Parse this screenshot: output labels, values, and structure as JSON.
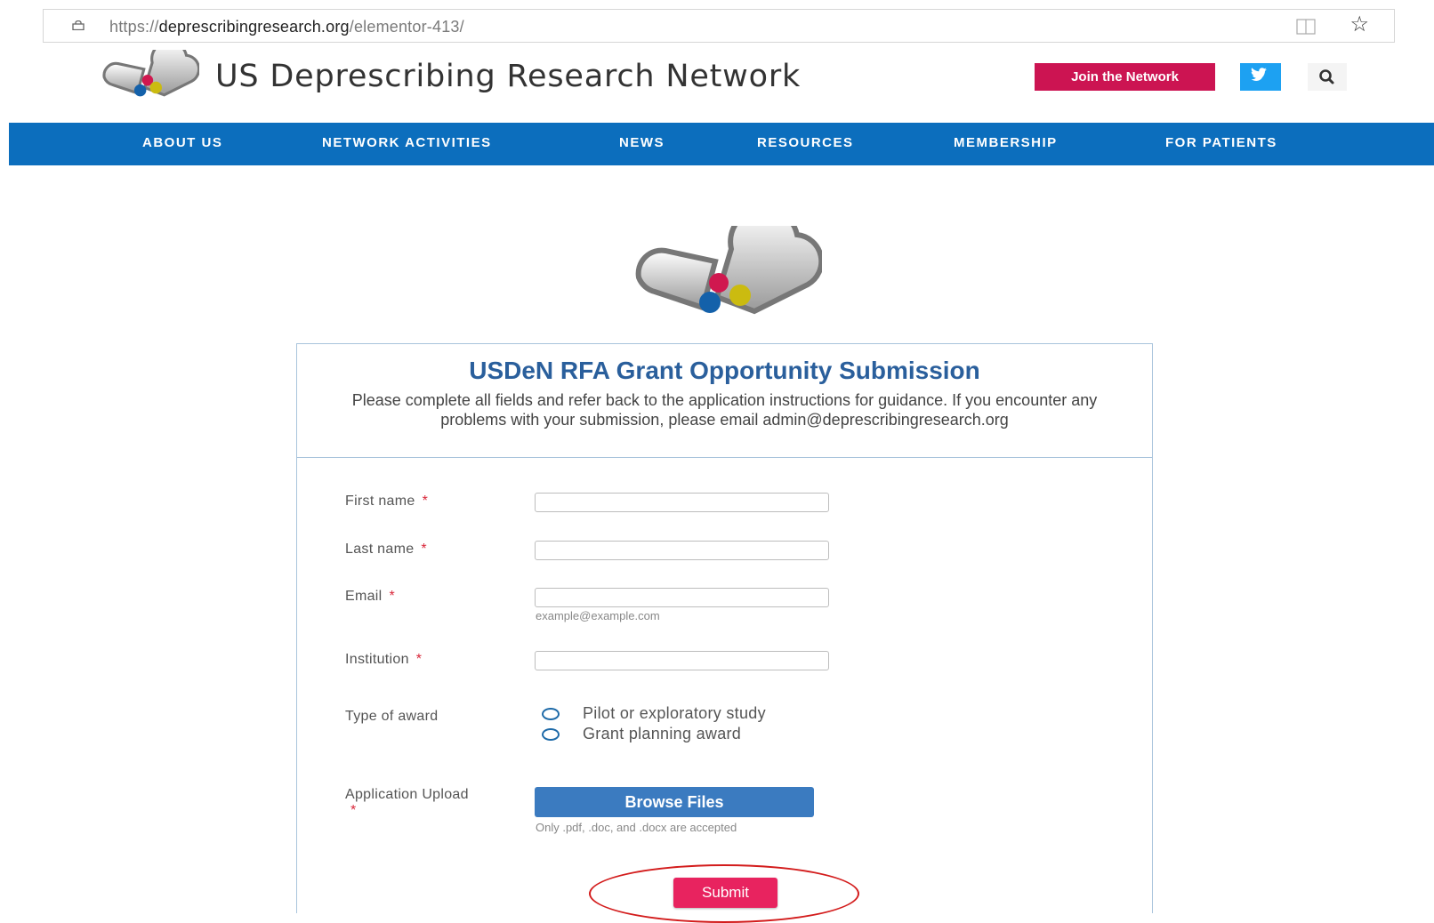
{
  "browser": {
    "url_prefix": "https://",
    "url_domain": "deprescribingresearch.org",
    "url_path": "/elementor-413/"
  },
  "header": {
    "site_title": "US Deprescribing Research Network",
    "join_label": "Join the Network"
  },
  "nav": {
    "items": [
      {
        "label": "ABOUT US"
      },
      {
        "label": "NETWORK ACTIVITIES"
      },
      {
        "label": "NEWS"
      },
      {
        "label": "RESOURCES"
      },
      {
        "label": "MEMBERSHIP"
      },
      {
        "label": "FOR PATIENTS"
      }
    ]
  },
  "form": {
    "title": "USDeN RFA Grant Opportunity Submission",
    "description": "Please complete all fields and refer back to the application instructions for guidance. If you encounter any problems with your submission, please email admin@deprescribingresearch.org",
    "required_mark": "*",
    "first_name": {
      "label": "First name",
      "value": ""
    },
    "last_name": {
      "label": "Last name",
      "value": ""
    },
    "email": {
      "label": "Email",
      "value": "",
      "hint": "example@example.com"
    },
    "institution": {
      "label": "Institution",
      "value": ""
    },
    "award": {
      "label": "Type of award",
      "options": [
        "Pilot or exploratory study",
        "Grant planning award"
      ]
    },
    "upload": {
      "label": "Application Upload",
      "button": "Browse Files",
      "hint": "Only .pdf, .doc, and .docx are accepted"
    },
    "submit_label": "Submit"
  },
  "colors": {
    "nav_bg": "#0c6ebd",
    "join_bg": "#cc1452",
    "title_blue": "#2a5f9c",
    "browse_bg": "#3b7bc0",
    "submit_bg": "#e8235f",
    "annotation_red": "#d31c1c"
  },
  "icons": [
    "lock-icon",
    "reader-view-icon",
    "bookmark-star-icon",
    "twitter-icon",
    "search-icon"
  ]
}
